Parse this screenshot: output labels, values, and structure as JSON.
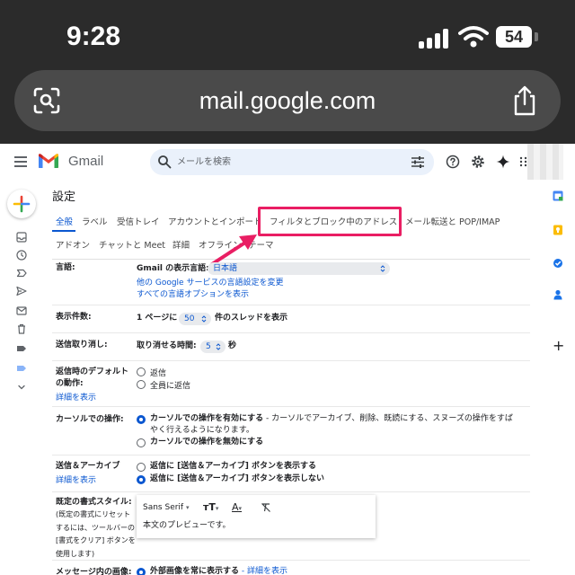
{
  "status_bar": {
    "time": "9:28",
    "battery": "54"
  },
  "browser": {
    "url": "mail.google.com"
  },
  "gmail": {
    "app_name": "Gmail",
    "search_placeholder": "メールを検索"
  },
  "settings": {
    "title": "設定",
    "tabs": [
      {
        "label": "全般",
        "active": true
      },
      {
        "label": "ラベル"
      },
      {
        "label": "受信トレイ"
      },
      {
        "label": "アカウントとインポート"
      },
      {
        "label": "フィルタとブロック中のアドレス"
      },
      {
        "label": "メール転送と POP/IMAP"
      },
      {
        "label": "アドオン"
      },
      {
        "label": "チャットと Meet"
      },
      {
        "label": "詳細"
      },
      {
        "label": "オフライン"
      },
      {
        "label": "テーマ"
      }
    ],
    "language": {
      "label": "言語:",
      "display_language_label": "Gmail の表示言語:",
      "display_language_value": "日本語",
      "change_link": "他の Google サービスの言語設定を変更",
      "show_all_link": "すべての言語オプションを表示"
    },
    "page_size": {
      "label": "表示件数:",
      "prefix": "1 ページに",
      "value": "50",
      "suffix": "件のスレッドを表示"
    },
    "undo_send": {
      "label": "送信取り消し:",
      "prefix": "取り消せる時間:",
      "value": "5",
      "suffix": "秒"
    },
    "reply_default": {
      "label_line1": "返信時のデフォルト",
      "label_line2": "の動作:",
      "details_link": "詳細を表示",
      "options": [
        "返信",
        "全員に返信"
      ]
    },
    "cursor": {
      "label": "カーソルでの操作:",
      "option_on_bold": "カーソルでの操作を有効にする",
      "option_on_desc_line1": " - カーソルでアーカイブ、削除、既読にする、スヌーズの操作をすば",
      "option_on_desc_line2": "やく行えるようになります。",
      "option_off": "カーソルでの操作を無効にする"
    },
    "send_archive": {
      "label": "送信＆アーカイブ",
      "details_link": "詳細を表示",
      "option_show": "返信に [送信＆アーカイブ] ボタンを表示する",
      "option_hide": "返信に [送信＆アーカイブ] ボタンを表示しない"
    },
    "default_style": {
      "label": "既定の書式スタイル:",
      "note_lines": [
        "(既定の書式にリセット",
        "するには、ツールバーの",
        "[書式をクリア] ボタンを",
        "使用します)"
      ],
      "font": "Sans Serif",
      "preview": "本文のプレビューです。"
    },
    "images": {
      "label": "メッセージ内の画像:",
      "option": "外部画像を常に表示する",
      "details_link": " - 詳細を表示"
    }
  }
}
